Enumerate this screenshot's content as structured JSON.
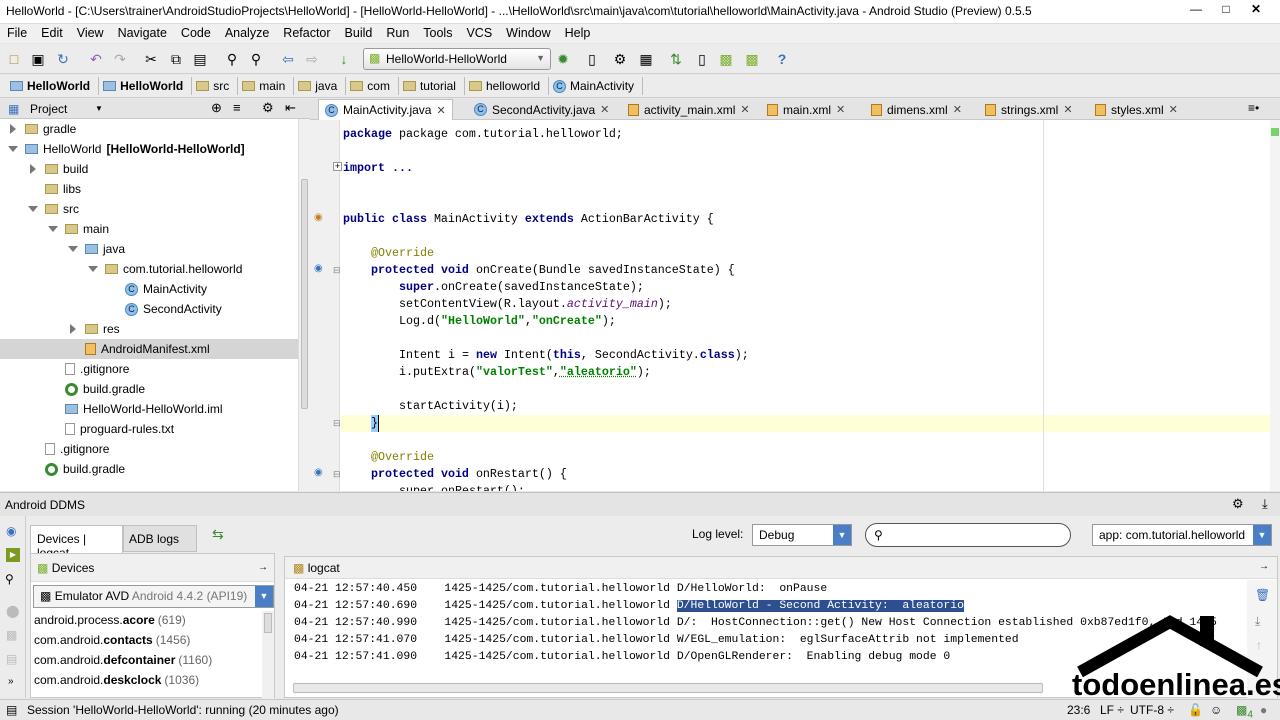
{
  "window": {
    "title": "HelloWorld - [C:\\Users\\trainer\\AndroidStudioProjects\\HelloWorld] - [HelloWorld-HelloWorld] - ...\\HelloWorld\\src\\main\\java\\com\\tutorial\\helloworld\\MainActivity.java - Android Studio (Preview) 0.5.5"
  },
  "menu": [
    "File",
    "Edit",
    "View",
    "Navigate",
    "Code",
    "Analyze",
    "Refactor",
    "Build",
    "Run",
    "Tools",
    "VCS",
    "Window",
    "Help"
  ],
  "toolbar": {
    "run_config": "HelloWorld-HelloWorld"
  },
  "breadcrumb": [
    "HelloWorld",
    "HelloWorld",
    "src",
    "main",
    "java",
    "com",
    "tutorial",
    "helloworld",
    "MainActivity"
  ],
  "project": {
    "title": "Project",
    "tree": [
      {
        "label": "gradle",
        "depth": 1,
        "icon": "folder",
        "arrow": "right"
      },
      {
        "label": "HelloWorld",
        "extra": "[HelloWorld-HelloWorld]",
        "depth": 1,
        "icon": "module",
        "arrow": "down"
      },
      {
        "label": "build",
        "depth": 2,
        "icon": "folder",
        "arrow": "right"
      },
      {
        "label": "libs",
        "depth": 2,
        "icon": "folder",
        "arrow": ""
      },
      {
        "label": "src",
        "depth": 2,
        "icon": "folder",
        "arrow": "down"
      },
      {
        "label": "main",
        "depth": 3,
        "icon": "folder",
        "arrow": "down"
      },
      {
        "label": "java",
        "depth": 4,
        "icon": "folder-blue",
        "arrow": "down"
      },
      {
        "label": "com.tutorial.helloworld",
        "depth": 5,
        "icon": "package",
        "arrow": "down"
      },
      {
        "label": "MainActivity",
        "depth": 6,
        "icon": "class",
        "arrow": ""
      },
      {
        "label": "SecondActivity",
        "depth": 6,
        "icon": "class",
        "arrow": ""
      },
      {
        "label": "res",
        "depth": 4,
        "icon": "folder",
        "arrow": "right"
      },
      {
        "label": "AndroidManifest.xml",
        "depth": 4,
        "icon": "xml",
        "arrow": "",
        "selected": true
      },
      {
        "label": ".gitignore",
        "depth": 3,
        "icon": "file",
        "arrow": ""
      },
      {
        "label": "build.gradle",
        "depth": 3,
        "icon": "gradle",
        "arrow": ""
      },
      {
        "label": "HelloWorld-HelloWorld.iml",
        "depth": 3,
        "icon": "iml",
        "arrow": ""
      },
      {
        "label": "proguard-rules.txt",
        "depth": 3,
        "icon": "file",
        "arrow": ""
      },
      {
        "label": ".gitignore",
        "depth": 2,
        "icon": "file",
        "arrow": ""
      },
      {
        "label": "build.gradle",
        "depth": 2,
        "icon": "gradle",
        "arrow": ""
      }
    ]
  },
  "tabs": [
    {
      "label": "MainActivity.java",
      "icon": "class",
      "active": true
    },
    {
      "label": "SecondActivity.java",
      "icon": "class"
    },
    {
      "label": "activity_main.xml",
      "icon": "xml"
    },
    {
      "label": "main.xml",
      "icon": "xml"
    },
    {
      "label": "dimens.xml",
      "icon": "xml"
    },
    {
      "label": "strings.xml",
      "icon": "xml"
    },
    {
      "label": "styles.xml",
      "icon": "xml"
    }
  ],
  "code": {
    "l0": "package com.tutorial.helloworld;",
    "l1": "import ...",
    "l2a": "public class ",
    "l2b": "MainActivity ",
    "l2c": "extends ",
    "l2d": "ActionBarActivity {",
    "l3": "@Override",
    "l4a": "protected void ",
    "l4b": "onCreate(Bundle savedInstanceState) {",
    "l5": "super.onCreate(savedInstanceState);",
    "l6a": "setContentView(R.layout.",
    "l6b": "activity_main",
    "l6c": ");",
    "l7a": "Log.d(",
    "l7b": "\"HelloWorld\"",
    "l7c": ",",
    "l7d": "\"onCreate\"",
    "l7e": ");",
    "l8a": "Intent i = ",
    "l8b": "new ",
    "l8c": "Intent(",
    "l8d": "this",
    ", ": "",
    "l8e": ", SecondActivity.",
    "l8f": "class",
    "l8g": ");",
    "l9a": "i.putExtra(",
    "l9b": "\"valorTest\"",
    "l9c": ",",
    "l9d": "\"aleatorio\"",
    "l9e": ");",
    "l10": "startActivity(i);",
    "l11": "}",
    "l12": "@Override",
    "l13a": "protected void ",
    "l13b": "onRestart() {",
    "l14": "super.onRestart();"
  },
  "ddms": {
    "title": "Android DDMS",
    "tab_devices": "Devices | logcat",
    "tab_adb": "ADB logs",
    "devices_title": "Devices",
    "device": "Emulator AVD",
    "device_version": "Android 4.4.2 (API19)",
    "processes": [
      {
        "pre": "android.process.",
        "bold": "acore",
        "pid": "(619)"
      },
      {
        "pre": "com.android.",
        "bold": "contacts",
        "pid": "(1456)"
      },
      {
        "pre": "com.android.",
        "bold": "defcontainer",
        "pid": "(1160)"
      },
      {
        "pre": "com.android.",
        "bold": "deskclock",
        "pid": "(1036)"
      }
    ],
    "log_level_label": "Log level:",
    "log_level": "Debug",
    "search_placeholder": "",
    "app_filter": "app: com.tutorial.helloworld",
    "logcat_title": "logcat",
    "log": [
      {
        "ts": "04-21 12:57:40.450",
        "src": "1425-1425/com.tutorial.helloworld",
        "msg": "D/HelloWorld:  onPause"
      },
      {
        "ts": "04-21 12:57:40.690",
        "src": "1425-1425/com.tutorial.helloworld",
        "msg": "D/HelloWorld - Second Activity:  aleatorio",
        "selected": true
      },
      {
        "ts": "04-21 12:57:40.990",
        "src": "1425-1425/com.tutorial.helloworld",
        "msg": "D/:  HostConnection::get() New Host Connection established 0xb87ed1f0, tid 1425"
      },
      {
        "ts": "04-21 12:57:41.070",
        "src": "1425-1425/com.tutorial.helloworld",
        "msg": "W/EGL_emulation:  eglSurfaceAttrib not implemented"
      },
      {
        "ts": "04-21 12:57:41.090",
        "src": "1425-1425/com.tutorial.helloworld",
        "msg": "D/OpenGLRenderer:  Enabling debug mode 0"
      }
    ]
  },
  "status": {
    "session": "Session 'HelloWorld-HelloWorld': running (20 minutes ago)",
    "position": "23:6",
    "line_sep": "LF ÷",
    "encoding": "UTF-8 ÷",
    "notifications": "4"
  },
  "watermark": "todoenlinea.es"
}
